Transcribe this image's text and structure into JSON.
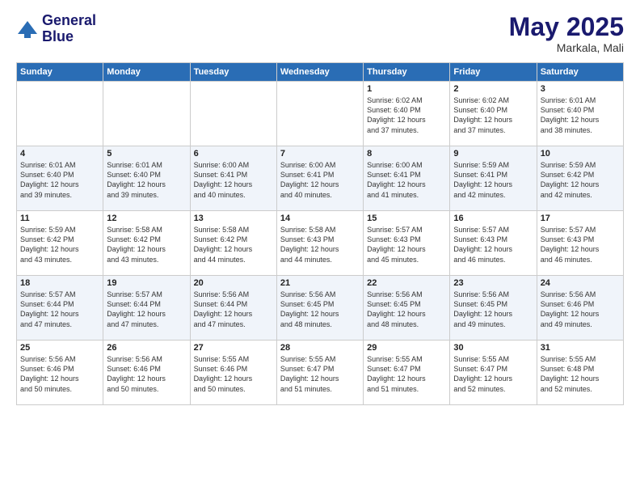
{
  "header": {
    "logo_line1": "General",
    "logo_line2": "Blue",
    "month": "May 2025",
    "location": "Markala, Mali"
  },
  "days_of_week": [
    "Sunday",
    "Monday",
    "Tuesday",
    "Wednesday",
    "Thursday",
    "Friday",
    "Saturday"
  ],
  "weeks": [
    [
      {
        "day": "",
        "text": ""
      },
      {
        "day": "",
        "text": ""
      },
      {
        "day": "",
        "text": ""
      },
      {
        "day": "",
        "text": ""
      },
      {
        "day": "1",
        "text": "Sunrise: 6:02 AM\nSunset: 6:40 PM\nDaylight: 12 hours\nand 37 minutes."
      },
      {
        "day": "2",
        "text": "Sunrise: 6:02 AM\nSunset: 6:40 PM\nDaylight: 12 hours\nand 37 minutes."
      },
      {
        "day": "3",
        "text": "Sunrise: 6:01 AM\nSunset: 6:40 PM\nDaylight: 12 hours\nand 38 minutes."
      }
    ],
    [
      {
        "day": "4",
        "text": "Sunrise: 6:01 AM\nSunset: 6:40 PM\nDaylight: 12 hours\nand 39 minutes."
      },
      {
        "day": "5",
        "text": "Sunrise: 6:01 AM\nSunset: 6:40 PM\nDaylight: 12 hours\nand 39 minutes."
      },
      {
        "day": "6",
        "text": "Sunrise: 6:00 AM\nSunset: 6:41 PM\nDaylight: 12 hours\nand 40 minutes."
      },
      {
        "day": "7",
        "text": "Sunrise: 6:00 AM\nSunset: 6:41 PM\nDaylight: 12 hours\nand 40 minutes."
      },
      {
        "day": "8",
        "text": "Sunrise: 6:00 AM\nSunset: 6:41 PM\nDaylight: 12 hours\nand 41 minutes."
      },
      {
        "day": "9",
        "text": "Sunrise: 5:59 AM\nSunset: 6:41 PM\nDaylight: 12 hours\nand 42 minutes."
      },
      {
        "day": "10",
        "text": "Sunrise: 5:59 AM\nSunset: 6:42 PM\nDaylight: 12 hours\nand 42 minutes."
      }
    ],
    [
      {
        "day": "11",
        "text": "Sunrise: 5:59 AM\nSunset: 6:42 PM\nDaylight: 12 hours\nand 43 minutes."
      },
      {
        "day": "12",
        "text": "Sunrise: 5:58 AM\nSunset: 6:42 PM\nDaylight: 12 hours\nand 43 minutes."
      },
      {
        "day": "13",
        "text": "Sunrise: 5:58 AM\nSunset: 6:42 PM\nDaylight: 12 hours\nand 44 minutes."
      },
      {
        "day": "14",
        "text": "Sunrise: 5:58 AM\nSunset: 6:43 PM\nDaylight: 12 hours\nand 44 minutes."
      },
      {
        "day": "15",
        "text": "Sunrise: 5:57 AM\nSunset: 6:43 PM\nDaylight: 12 hours\nand 45 minutes."
      },
      {
        "day": "16",
        "text": "Sunrise: 5:57 AM\nSunset: 6:43 PM\nDaylight: 12 hours\nand 46 minutes."
      },
      {
        "day": "17",
        "text": "Sunrise: 5:57 AM\nSunset: 6:43 PM\nDaylight: 12 hours\nand 46 minutes."
      }
    ],
    [
      {
        "day": "18",
        "text": "Sunrise: 5:57 AM\nSunset: 6:44 PM\nDaylight: 12 hours\nand 47 minutes."
      },
      {
        "day": "19",
        "text": "Sunrise: 5:57 AM\nSunset: 6:44 PM\nDaylight: 12 hours\nand 47 minutes."
      },
      {
        "day": "20",
        "text": "Sunrise: 5:56 AM\nSunset: 6:44 PM\nDaylight: 12 hours\nand 47 minutes."
      },
      {
        "day": "21",
        "text": "Sunrise: 5:56 AM\nSunset: 6:45 PM\nDaylight: 12 hours\nand 48 minutes."
      },
      {
        "day": "22",
        "text": "Sunrise: 5:56 AM\nSunset: 6:45 PM\nDaylight: 12 hours\nand 48 minutes."
      },
      {
        "day": "23",
        "text": "Sunrise: 5:56 AM\nSunset: 6:45 PM\nDaylight: 12 hours\nand 49 minutes."
      },
      {
        "day": "24",
        "text": "Sunrise: 5:56 AM\nSunset: 6:46 PM\nDaylight: 12 hours\nand 49 minutes."
      }
    ],
    [
      {
        "day": "25",
        "text": "Sunrise: 5:56 AM\nSunset: 6:46 PM\nDaylight: 12 hours\nand 50 minutes."
      },
      {
        "day": "26",
        "text": "Sunrise: 5:56 AM\nSunset: 6:46 PM\nDaylight: 12 hours\nand 50 minutes."
      },
      {
        "day": "27",
        "text": "Sunrise: 5:55 AM\nSunset: 6:46 PM\nDaylight: 12 hours\nand 50 minutes."
      },
      {
        "day": "28",
        "text": "Sunrise: 5:55 AM\nSunset: 6:47 PM\nDaylight: 12 hours\nand 51 minutes."
      },
      {
        "day": "29",
        "text": "Sunrise: 5:55 AM\nSunset: 6:47 PM\nDaylight: 12 hours\nand 51 minutes."
      },
      {
        "day": "30",
        "text": "Sunrise: 5:55 AM\nSunset: 6:47 PM\nDaylight: 12 hours\nand 52 minutes."
      },
      {
        "day": "31",
        "text": "Sunrise: 5:55 AM\nSunset: 6:48 PM\nDaylight: 12 hours\nand 52 minutes."
      }
    ]
  ]
}
